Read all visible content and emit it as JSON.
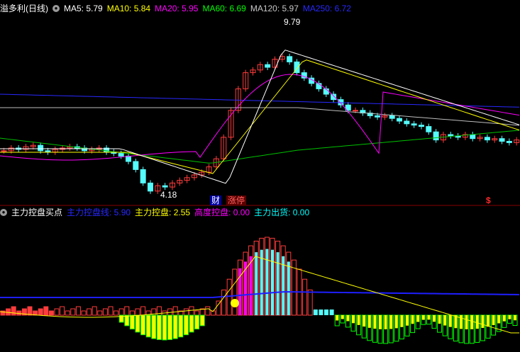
{
  "main": {
    "title": "溢多利(日线)",
    "indicators": [
      {
        "label": "MA5: 5.79",
        "color": "#ffffff"
      },
      {
        "label": "MA10: 5.84",
        "color": "#ffff00"
      },
      {
        "label": "MA20: 5.95",
        "color": "#ff00ff"
      },
      {
        "label": "MA60: 6.69",
        "color": "#00ff00"
      },
      {
        "label": "MA120: 5.97",
        "color": "#c8c8c8"
      },
      {
        "label": "MA250: 6.72",
        "color": "#0000ff"
      }
    ],
    "high_label": "9.79",
    "low_label": "4.18",
    "badges": {
      "cai": "财",
      "zhangting": "涨停",
      "dollar": "$"
    }
  },
  "sub": {
    "title": "主力控盘买点",
    "indicators": [
      {
        "label": "主力控盘线: 5.90",
        "color": "#0000ff"
      },
      {
        "label": "主力控盘: 2.55",
        "color": "#ffff00"
      },
      {
        "label": "高度控盘: 0.00",
        "color": "#ff00ff"
      },
      {
        "label": "主力出货: 0.00",
        "color": "#00ffff"
      }
    ],
    "marker": "$"
  },
  "colors": {
    "up": "#ff3c3c",
    "down": "#54fcfc",
    "bg": "#000000"
  }
}
